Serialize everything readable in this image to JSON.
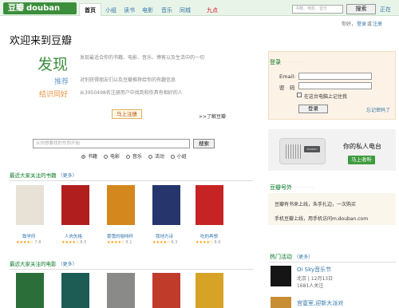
{
  "nav": {
    "logo": "豆瓣",
    "logo_latin": "douban",
    "items": [
      {
        "label": "首页"
      },
      {
        "label": "小组"
      },
      {
        "label": "读书"
      },
      {
        "label": "电影"
      },
      {
        "label": "音乐"
      },
      {
        "label": "同城"
      },
      {
        "label": "九点"
      }
    ],
    "search_placeholder": "书籍、电影、音乐",
    "search_button": "搜索",
    "more": "正在"
  },
  "account": {
    "greeting": "你好，",
    "login": "登录",
    "or": "或",
    "register": "注册"
  },
  "intro": {
    "title": "欢迎来到豆瓣",
    "discover": "发现",
    "recommend": "推荐",
    "meet": "结识同好",
    "discover_text": "发现最适合你的书籍、电影、音乐、博客以及生活中的一切",
    "recommend_text": "对别获得朋友们以及豆瓣推荐给你的有趣信息",
    "meet_text": "从3950498名注册用户中找到和你具有相好的人",
    "register_button": "马上注册",
    "learn_more": ">>了解豆瓣"
  },
  "main_search": {
    "placeholder": "从你想要找的东西开始",
    "button": "搜索",
    "categories": [
      "书籍",
      "电影",
      "音乐",
      "活动",
      "小组"
    ],
    "selected": 0
  },
  "books_section": {
    "title": "最近大家关注的书籍",
    "more": "（更多）",
    "items": [
      {
        "title": "致学府",
        "stars": "★★★★☆",
        "rating": "7.8",
        "color": "#e8e2d6"
      },
      {
        "title": "人肉失格",
        "stars": "★★★★☆",
        "rating": "8.5",
        "color": "#b01e1e"
      },
      {
        "title": "雾霭的咖啡杯",
        "stars": "★★★★☆",
        "rating": "8.1",
        "color": "#d4871c"
      },
      {
        "title": "我地方诗",
        "stars": "★★★★☆",
        "rating": "8.3",
        "color": "#26356c"
      },
      {
        "title": "吃的再想",
        "stars": "★★★★☆",
        "rating": "8.6",
        "color": "#c62424"
      }
    ]
  },
  "movies_section": {
    "title": "最近大家关注的电影",
    "more": "（更多）",
    "items": [
      {
        "color": "#2b6e3a"
      },
      {
        "color": "#1c5c55"
      },
      {
        "color": "#8a8a88"
      },
      {
        "color": "#c13b2b"
      },
      {
        "color": "#d7a326"
      }
    ]
  },
  "login": {
    "title": "登录",
    "email_label": "Email:",
    "password_label": "密　码",
    "remember": "在这台电脑上记住我",
    "button": "登录",
    "forgot": "忘记密码了"
  },
  "radio": {
    "title": "你的私人电台",
    "button": "马上收听",
    "display": "douban"
  },
  "phone": {
    "title": "豆瓣号外",
    "line1": "豆瓣有书来上线，朱手扎边，一次购买",
    "line2": "手机豆瓣上线，用手机访问m.douban.com"
  },
  "events": {
    "title": "热门活动",
    "more": "（更多）",
    "items": [
      {
        "title": "Oi Sky音乐节",
        "date": "北京 | 12月13日",
        "count": "1681人关注",
        "color": "#151515"
      },
      {
        "title": "宫壹室,迎新大派对",
        "date": "",
        "count": "",
        "color": "#c88e34"
      }
    ]
  }
}
